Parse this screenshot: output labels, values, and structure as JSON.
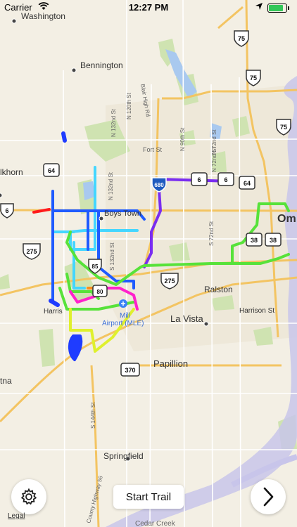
{
  "status_bar": {
    "carrier": "Carrier",
    "time": "12:27 PM",
    "wifi_icon": "wifi-icon",
    "location_icon": "location-arrow-icon",
    "battery_icon": "battery-icon"
  },
  "map": {
    "places": {
      "washington": "Washington",
      "bennington": "Bennington",
      "elkhorn": "lkhorn",
      "boys_town": "Boys Town",
      "ralston": "Ralston",
      "la_vista": "La Vista",
      "harrison": "Harris",
      "harrison_st": "Harrison St",
      "papillion": "Papillion",
      "gretna": "tna",
      "springfield": "Springfield",
      "omaha": "Om",
      "airport_1": "Mill",
      "airport_2": "Airport (MLE)",
      "fort_st": "Fort St"
    },
    "roads": {
      "blair_high": "Blair High Rd",
      "n120": "N 120th St",
      "n132": "N 132nd St",
      "n90": "N 90th St",
      "n72": "N 72nd St",
      "n72b": "N 72nd St",
      "s72": "S 72nd St",
      "s132": "S 132nd St",
      "s144": "S 144th St",
      "county_hwy": "County Highway 56",
      "cedar_creek": "Cedar Creek"
    },
    "shields": {
      "us75_top": "75",
      "us75_mid": "75",
      "us75_right": "75",
      "hwy64_left": "64",
      "hwy64_right": "64",
      "us6_left": "6",
      "us6_mid": "6",
      "us6_right": "6",
      "i680": "680",
      "us275_left": "275",
      "us275_mid": "275",
      "hwy38_a": "38",
      "hwy38_b": "38",
      "hwy370": "370",
      "i80": "80",
      "hwy85": "85"
    },
    "colors": {
      "land": "#f3efe4",
      "park": "#cfe3b1",
      "water": "#a9c9ef",
      "river": "#c8c5ea",
      "highway": "#f3c462",
      "arterial": "#ffffff",
      "trail_green": "#57e23a",
      "trail_blue": "#1f5bff",
      "trail_cyan": "#44d6ff",
      "trail_purple": "#7a2df0",
      "trail_magenta": "#ff22cc",
      "trail_yellow": "#dff02d",
      "trail_red": "#ff1a1a",
      "trail_orange": "#ff8a1a"
    }
  },
  "controls": {
    "settings_icon": "gear-icon",
    "start_trail": "Start Trail",
    "next_icon": "chevron-right-icon",
    "legal": "Legal"
  }
}
